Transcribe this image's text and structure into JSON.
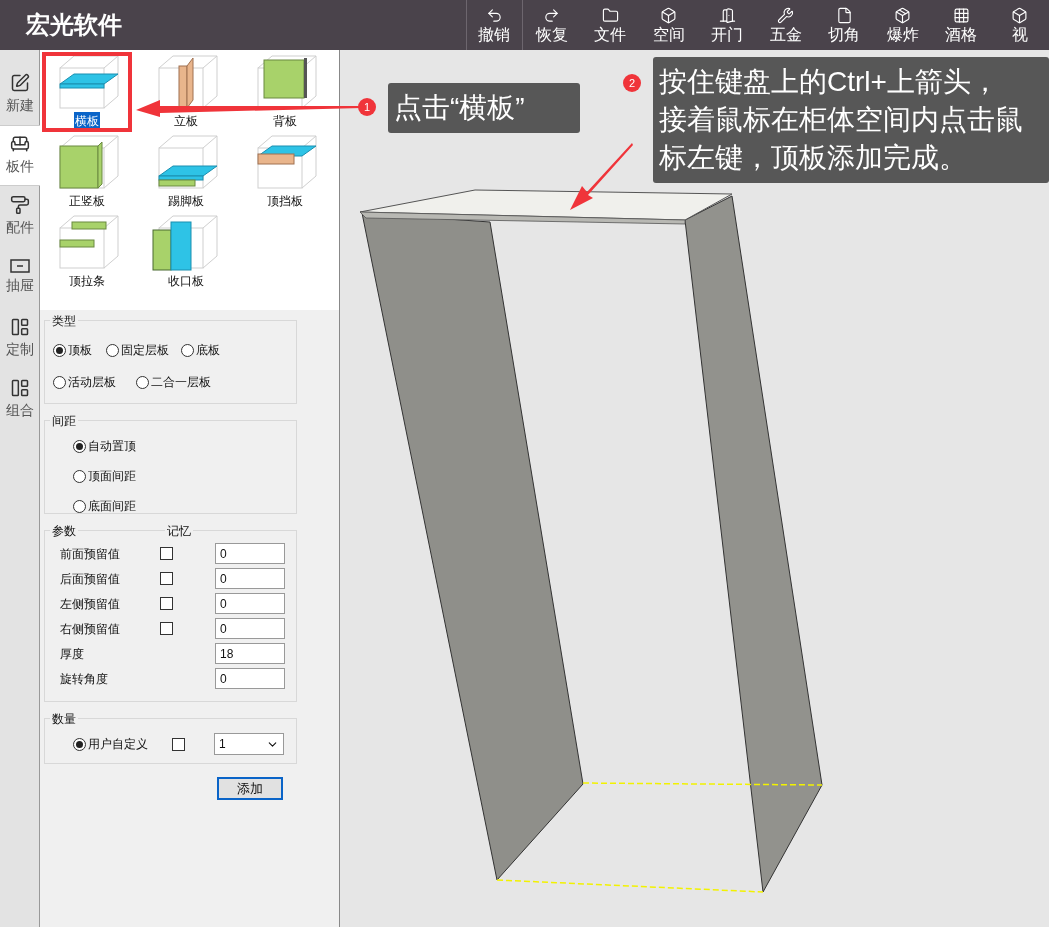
{
  "app": {
    "title": "宏光软件"
  },
  "toolbar": [
    {
      "label": "撤销"
    },
    {
      "label": "恢复"
    },
    {
      "label": "文件"
    },
    {
      "label": "空间"
    },
    {
      "label": "开门"
    },
    {
      "label": "五金"
    },
    {
      "label": "切角"
    },
    {
      "label": "爆炸"
    },
    {
      "label": "酒格"
    },
    {
      "label": "视"
    }
  ],
  "side_tabs": [
    {
      "label": "新建",
      "selected": false
    },
    {
      "label": "板件",
      "selected": true
    },
    {
      "label": "配件",
      "selected": false
    },
    {
      "label": "抽屉",
      "selected": false
    },
    {
      "label": "定制",
      "selected": false
    },
    {
      "label": "组合",
      "selected": false
    }
  ],
  "board_types": [
    {
      "label": "横板",
      "selected": true
    },
    {
      "label": "立板",
      "selected": false
    },
    {
      "label": "背板",
      "selected": false
    },
    {
      "label": "正竖板",
      "selected": false
    },
    {
      "label": "踢脚板",
      "selected": false
    },
    {
      "label": "顶挡板",
      "selected": false
    },
    {
      "label": "顶拉条",
      "selected": false
    },
    {
      "label": "收口板",
      "selected": false
    }
  ],
  "type_group": {
    "title": "类型",
    "options": [
      {
        "label": "顶板",
        "selected": true
      },
      {
        "label": "固定层板",
        "selected": false
      },
      {
        "label": "底板",
        "selected": false
      },
      {
        "label": "活动层板",
        "selected": false
      },
      {
        "label": "二合一层板",
        "selected": false
      }
    ]
  },
  "spacing_group": {
    "title": "间距",
    "options": [
      {
        "label": "自动置顶",
        "selected": true
      },
      {
        "label": "顶面间距",
        "selected": false
      },
      {
        "label": "底面间距",
        "selected": false
      }
    ]
  },
  "params_group": {
    "title": "参数",
    "memory_header": "记忆",
    "rows": [
      {
        "label": "前面预留值",
        "kind": "memory",
        "checked": false,
        "value": "0"
      },
      {
        "label": "后面预留值",
        "kind": "memory",
        "checked": false,
        "value": "0"
      },
      {
        "label": "左侧预留值",
        "kind": "memory",
        "checked": false,
        "value": "0"
      },
      {
        "label": "右侧预留值",
        "kind": "memory",
        "checked": false,
        "value": "0"
      },
      {
        "label": "厚度",
        "kind": "plain",
        "value": "18"
      },
      {
        "label": "旋转角度",
        "kind": "plain",
        "value": "0"
      }
    ]
  },
  "quantity_group": {
    "title": "数量",
    "option": {
      "label": "用户自定义",
      "selected": true
    },
    "checked": false,
    "value": "1"
  },
  "add_button": "添加",
  "callouts": [
    {
      "number": "1",
      "lines": [
        "点击“横板”"
      ]
    },
    {
      "number": "2",
      "lines": [
        "按住键盘上的Ctrl+上箭头，",
        "接着鼠标在柜体空间内点击鼠",
        "标左键，顶板添加完成。"
      ]
    }
  ]
}
